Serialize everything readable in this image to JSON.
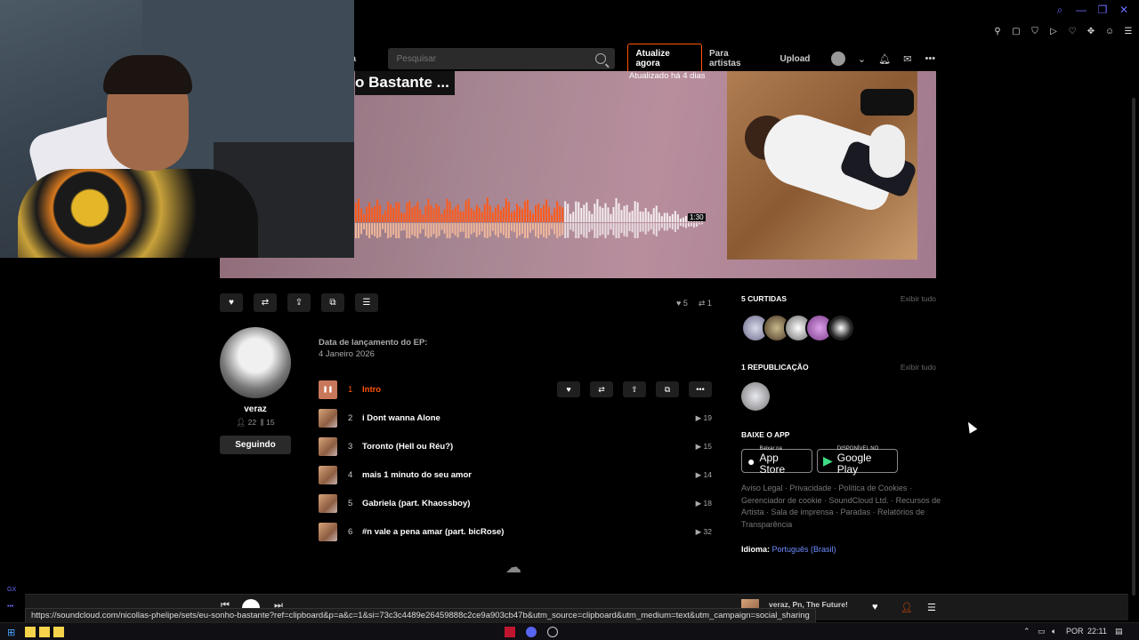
{
  "header": {
    "library_label": "teca",
    "search_placeholder": "Pesquisar",
    "upgrade_label": "Atualize agora",
    "for_artists_label": "Para artistas",
    "upload_label": "Upload"
  },
  "hero": {
    "title_visible": "o Bastante ...",
    "updated": "Atualizado há 4 dias",
    "waveform_time": "1:30",
    "progress_fraction": 0.6
  },
  "stats": {
    "likes": "5",
    "reposts": "1"
  },
  "artist": {
    "name": "veraz",
    "followers": "22",
    "tracks": "15",
    "follow_label": "Seguindo"
  },
  "release": {
    "label": "Data de lançamento do EP:",
    "date": "4 Janeiro 2026"
  },
  "tracks": [
    {
      "num": "1",
      "title": "Intro",
      "plays": ""
    },
    {
      "num": "2",
      "title": "i Dont wanna Alone",
      "plays": "19"
    },
    {
      "num": "3",
      "title": "Toronto (Hell ou Réu?)",
      "plays": "15"
    },
    {
      "num": "4",
      "title": "mais 1 minuto do seu amor",
      "plays": "14"
    },
    {
      "num": "5",
      "title": "Gabriela (part. Khaossboy)",
      "plays": "18"
    },
    {
      "num": "6",
      "title": "#n vale a pena amar (part. bicRose)",
      "plays": "32"
    }
  ],
  "sidebar": {
    "likes_title": "5 CURTIDAS",
    "see_all": "Exibir tudo",
    "reposts_title": "1 REPUBLICAÇÃO",
    "app_title": "BAIXE O APP",
    "appstore_small": "Baixar na",
    "appstore_big": "App Store",
    "googleplay_small": "DISPONÍVEL NO",
    "googleplay_big": "Google Play",
    "footer": "Aviso Legal · Privacidade · Política de Cookies · Gerenciador de cookie · SoundCloud Ltd. · Recursos de Artista · Sala de imprensa · Paradas · Relatórios de Transparência",
    "language_label": "Idioma:",
    "language_value": "Português (Brasil)"
  },
  "player": {
    "now_playing": "veraz, Pn, The Future!"
  },
  "status_url": "https://soundcloud.com/nicollas-phelipe/sets/eu-sonho-bastante?ref=clipboard&p=a&c=1&si=73c3c4489e26459888c2ce9a903cb47b&utm_source=clipboard&utm_medium=text&utm_campaign=social_sharing",
  "taskbar": {
    "lang": "POR",
    "time": "22:11"
  },
  "colors": {
    "accent": "#ff5500",
    "link": "#6f8cff"
  }
}
